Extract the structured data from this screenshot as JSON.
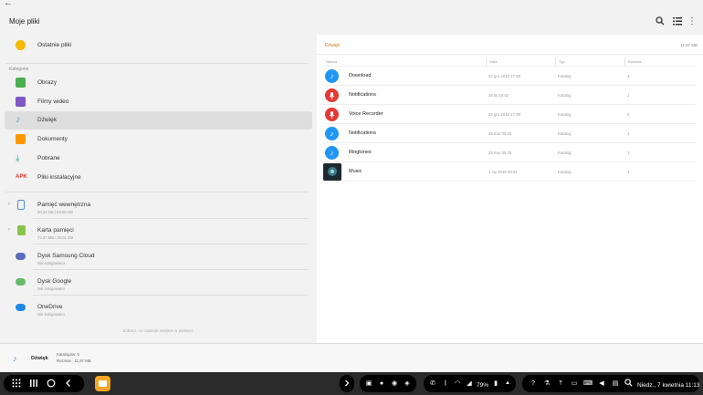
{
  "header": {
    "title": "Moje pliki"
  },
  "sidebar": {
    "recent": "Ostatnie pliki",
    "categories_label": "Kategorie",
    "categories": [
      {
        "label": "Obrazy",
        "color": "#4caf50"
      },
      {
        "label": "Filmy wideo",
        "color": "#7e57c2"
      },
      {
        "label": "Dźwięk",
        "color": "#42a5f5"
      },
      {
        "label": "Dokumenty",
        "color": "#ff9800"
      },
      {
        "label": "Pobrane",
        "color": "#26a69a"
      },
      {
        "label": "Pliki instalacyjne",
        "color": "#e53935"
      }
    ],
    "storage": [
      {
        "label": "Pamięć wewnętrzna",
        "sub": "30,34 GB / 64,00 GB"
      },
      {
        "label": "Karta pamięci",
        "sub": "72,47 MB / 30,01 GB"
      },
      {
        "label": "Dysk Samsung Cloud",
        "sub": "Nie zalogowano"
      },
      {
        "label": "Dysk Google",
        "sub": "Nie zalogowano"
      },
      {
        "label": "OneDrive",
        "sub": "Nie zalogowano"
      }
    ],
    "hint": "Zobacz, co zajmuje miejsce w pamięci."
  },
  "main": {
    "title": "Dźwięk",
    "size": "11,97 MB",
    "columns": [
      "Nazwa",
      "Data",
      "Typ",
      "Rozmiar"
    ],
    "rows": [
      {
        "name": "Download",
        "date": "22 gru 2018 17:08",
        "type": "Katalog",
        "count": "3",
        "icon": "music-note-icon",
        "color": "#2196f3"
      },
      {
        "name": "Notifications",
        "date": "26 lis 16:42",
        "type": "Katalog",
        "count": "1",
        "icon": "microphone-icon",
        "color": "#e53935"
      },
      {
        "name": "Voice Recorder",
        "date": "22 gru 2018 17:08",
        "type": "Katalog",
        "count": "2",
        "icon": "microphone-icon",
        "color": "#e53935"
      },
      {
        "name": "Notifications",
        "date": "28 mar 05:25",
        "type": "Katalog",
        "count": "1",
        "icon": "music-note-icon",
        "color": "#2196f3"
      },
      {
        "name": "Ringtones",
        "date": "28 mar 05:29",
        "type": "Katalog",
        "count": "1",
        "icon": "music-note-icon",
        "color": "#2196f3"
      },
      {
        "name": "Music",
        "date": "1 sty 2018 00:01",
        "type": "Katalog",
        "count": "1",
        "icon": "album-thumbnail",
        "color": "#1b2a30"
      }
    ]
  },
  "infobar": {
    "label": "Dźwięk",
    "folders": "Katalogów: 6",
    "size": "Rozmiar : 11,97 MB"
  },
  "taskbar": {
    "battery": "79%",
    "clock": "Niedz., 7 kwietnia 11:13"
  }
}
